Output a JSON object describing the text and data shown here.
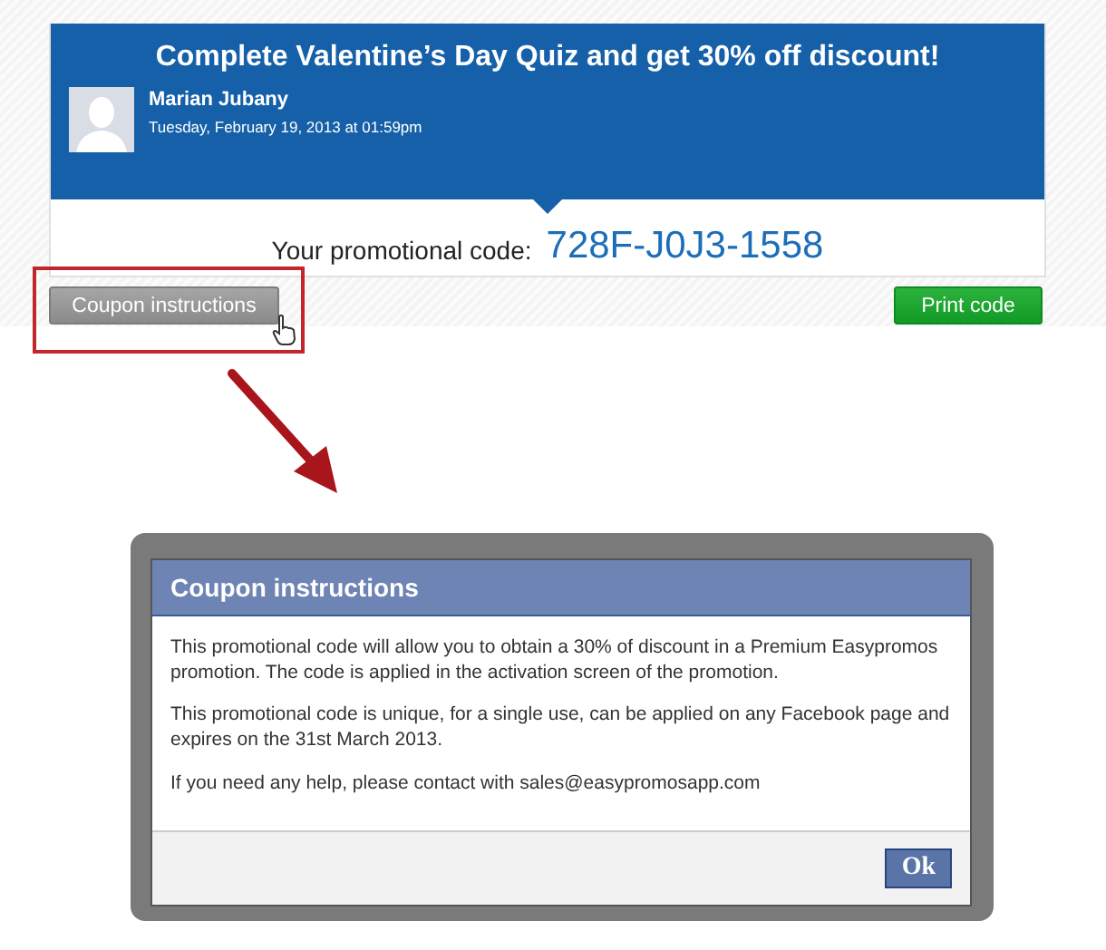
{
  "promo": {
    "title": "Complete Valentine’s Day Quiz and get 30% off discount!",
    "author": "Marian Jubany",
    "date": "Tuesday, February 19, 2013 at 01:59pm",
    "code_label": "Your promotional code:",
    "code": "728F-J0J3-1558"
  },
  "buttons": [
    {
      "label": "Coupon instructions",
      "kind": "secondary",
      "highlighted": true
    },
    {
      "label": "Print code",
      "kind": "primary",
      "highlighted": false
    }
  ],
  "dialog": {
    "title": "Coupon instructions",
    "paragraphs": [
      "This promotional code will allow you to obtain a 30% of discount in a Premium Easypromos promotion. The code is applied in the activation screen of the promotion.",
      "This promotional code is unique, for a single use, can be applied on any Facebook page and expires on the 31st March 2013.",
      "If you need any help, please contact with sales@easypromosapp.com"
    ],
    "button": "Ok"
  }
}
